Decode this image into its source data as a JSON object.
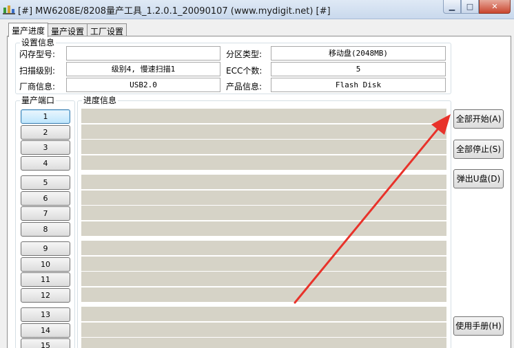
{
  "window": {
    "title": "[#] MW6208E/8208量产工具_1.2.0.1_20090107 (www.mydigit.net) [#]",
    "minimize_glyph": "▁",
    "maximize_glyph": "□",
    "close_glyph": "✕"
  },
  "tabs": [
    {
      "label": "量产进度",
      "active": true
    },
    {
      "label": "量产设置",
      "active": false
    },
    {
      "label": "工厂设置",
      "active": false
    }
  ],
  "settings_info": {
    "caption": "设置信息",
    "flash_model_label": "闪存型号:",
    "flash_model_value": "",
    "scan_level_label": "扫描级别:",
    "scan_level_value": "级别4, 慢速扫描1",
    "vendor_info_label": "厂商信息:",
    "vendor_info_value": "USB2.0",
    "partition_type_label": "分区类型:",
    "partition_type_value": "移动盘(2048MB)",
    "ecc_count_label": "ECC个数:",
    "ecc_count_value": "5",
    "product_info_label": "产品信息:",
    "product_info_value": "Flash Disk"
  },
  "ports": {
    "caption": "量产端口",
    "items": [
      "1",
      "2",
      "3",
      "4",
      "5",
      "6",
      "7",
      "8",
      "9",
      "10",
      "11",
      "12",
      "13",
      "14",
      "15"
    ]
  },
  "progress": {
    "caption": "进度信息"
  },
  "buttons": {
    "start_all": "全部开始(A)",
    "stop_all": "全部停止(S)",
    "eject_udisk": "弹出U盘(D)",
    "manual": "使用手册(H)"
  },
  "annotation": {
    "arrow_color": "#e8322a"
  }
}
